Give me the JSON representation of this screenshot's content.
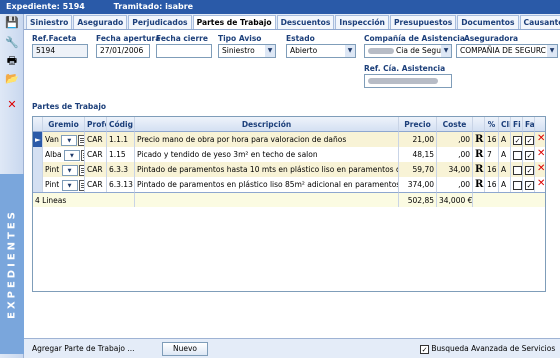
{
  "titlebar": {
    "expediente": "Expediente: 5194",
    "tramitado": "Tramitado: isabre"
  },
  "leftbar": {
    "vertical_label": "EXPEDIENTES"
  },
  "tabs": [
    {
      "label": "Siniestro"
    },
    {
      "label": "Asegurado"
    },
    {
      "label": "Perjudicados"
    },
    {
      "label": "Partes de Trabajo"
    },
    {
      "label": "Descuentos"
    },
    {
      "label": "Inspección"
    },
    {
      "label": "Presupuestos"
    },
    {
      "label": "Documentos"
    },
    {
      "label": "Causante"
    }
  ],
  "form": {
    "ref_faceta_label": "Ref.Faceta",
    "ref_faceta_value": "5194",
    "fecha_apertura_label": "Fecha apertura",
    "fecha_apertura_value": "27/01/2006",
    "fecha_cierre_label": "Fecha cierre",
    "fecha_cierre_value": "",
    "tipo_aviso_label": "Tipo Aviso",
    "tipo_aviso_value": "Siniestro",
    "estado_label": "Estado",
    "estado_value": "Abierto",
    "compania_label": "Compañía de Asistencia",
    "compania_value": "Cia de Seguros y",
    "aseguradora_label": "Aseguradora",
    "aseguradora_value": "COMPAÑIA DE SEGURC",
    "ref_cia_label": "Ref. Cía. Asistencia",
    "ref_cia_value": ""
  },
  "partes": {
    "section_label": "Partes de Trabajo",
    "columns": [
      "Gremio",
      "Profe",
      "Códig",
      "Descripción",
      "Precio",
      "Coste",
      "%",
      "Cli",
      "Fi",
      "Fa"
    ],
    "rows": [
      {
        "gremio": "Van",
        "profe": "CAR",
        "codigo": "1.1.1",
        "descripcion": "Precio mano de obra por hora para valoracion de daños",
        "precio": "21,00",
        "coste": ",00",
        "pct": "16",
        "cli": "A",
        "fi": true,
        "fa": true
      },
      {
        "gremio": "Alba",
        "profe": "CAR",
        "codigo": "1.15",
        "descripcion": "Picado y tendido de yeso 3m² en techo de salon",
        "precio": "48,15",
        "coste": ",00",
        "pct": "7",
        "cli": "A",
        "fi": false,
        "fa": true
      },
      {
        "gremio": "Pint",
        "profe": "CAR",
        "codigo": "6.3.3",
        "descripcion": "Pintado de paramentos hasta 10 mts en plástico liso en paramentos de",
        "precio": "59,70",
        "coste": "34,00",
        "pct": "16",
        "cli": "A",
        "fi": false,
        "fa": true
      },
      {
        "gremio": "Pint",
        "profe": "CAR",
        "codigo": "6.3.13",
        "descripcion": "Pintado de paramentos en plástico liso 85m² adicional en paramentos d",
        "precio": "374,00",
        "coste": ",00",
        "pct": "16",
        "cli": "A",
        "fi": false,
        "fa": true
      }
    ],
    "footer": {
      "count": "4 Lineas",
      "precio_total": "502,85",
      "coste_total": "34,000 €"
    }
  },
  "bottom": {
    "agregar_label": "Agregar Parte de Trabajo ...",
    "nuevo_button": "Nuevo",
    "busqueda_label": "Busqueda Avanzada de Servicios",
    "busqueda_checked": true
  },
  "colors": {
    "accent": "#2a5aa8",
    "row_alt": "#f8f3d6",
    "delete": "#dd0000"
  }
}
